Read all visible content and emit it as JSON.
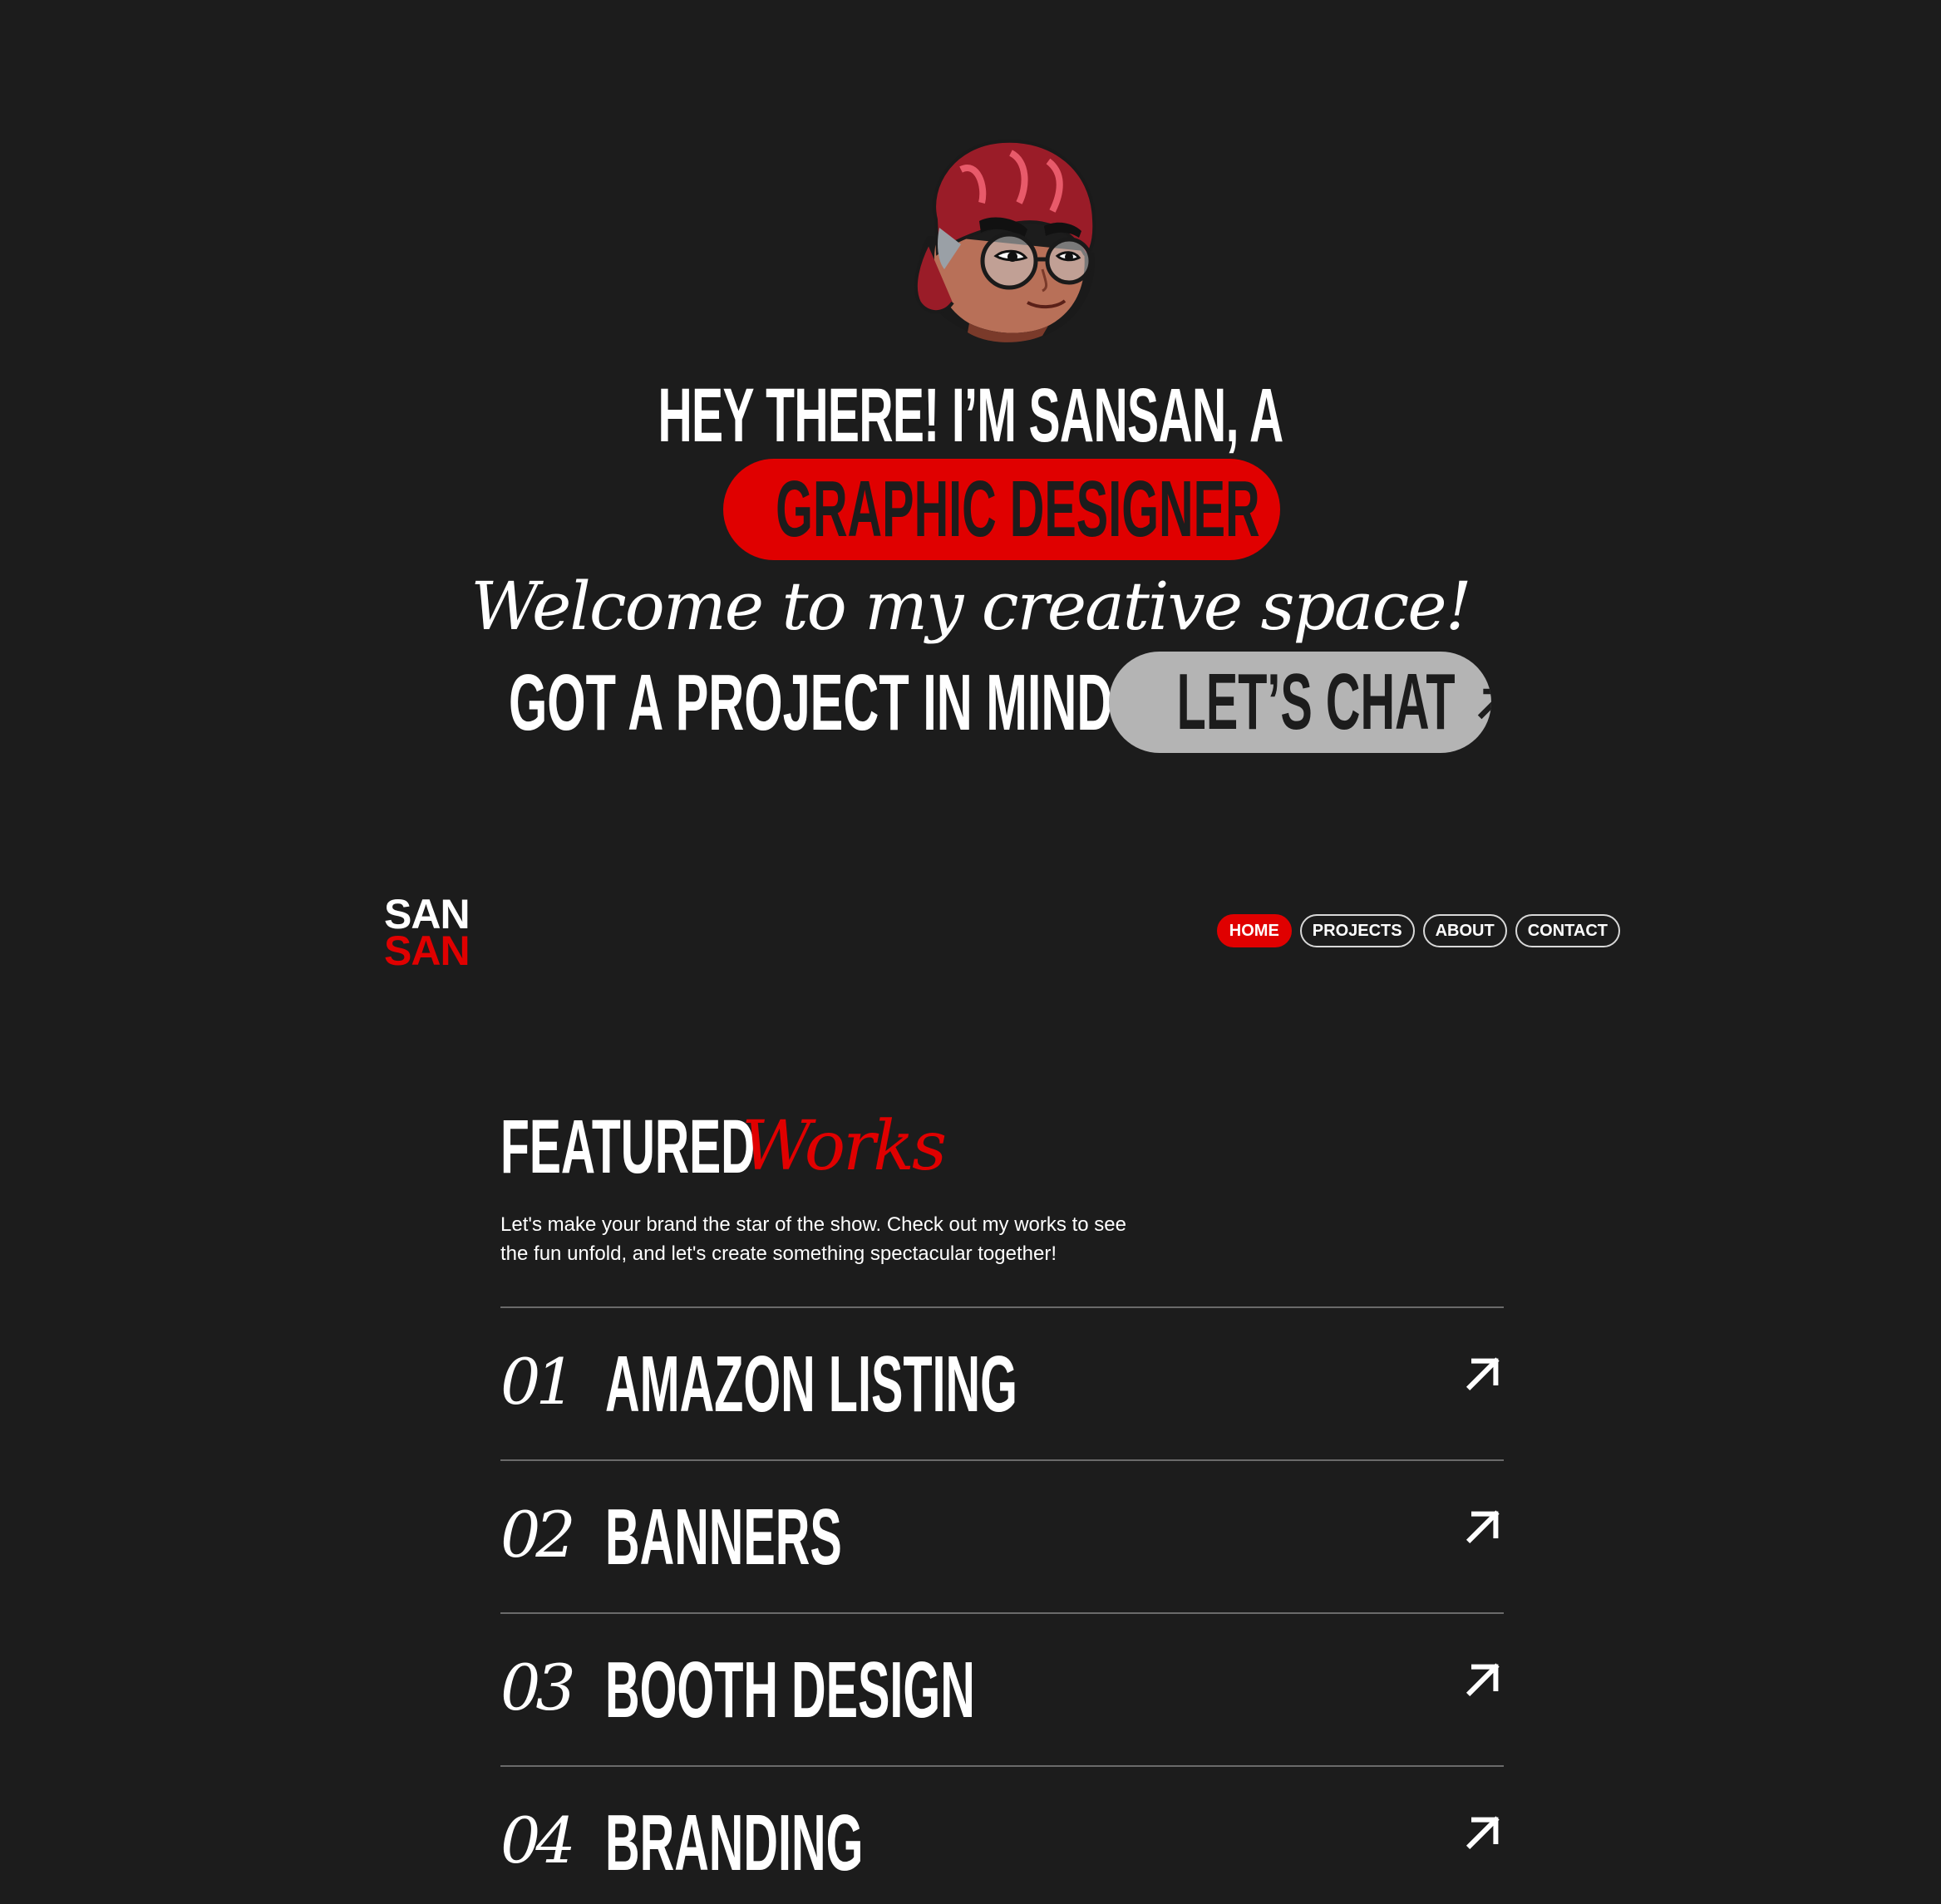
{
  "hero": {
    "avatar_icon": "cartoon-avatar-icon",
    "line1": "HEY THERE! I’M SANSAN, A",
    "role_button": "GRAPHIC DESIGNER",
    "welcome": "Welcome to my creative space!",
    "project_question": "GOT A PROJECT IN MIND?",
    "chat_button": "LET’S CHAT",
    "accent_color": "#e00000",
    "chat_color": "#b4b4b4"
  },
  "logo": {
    "line1": "SAN",
    "line2": "SAN"
  },
  "nav": {
    "items": [
      "HOME",
      "PROJECTS",
      "ABOUT",
      "CONTACT"
    ],
    "active": "HOME"
  },
  "featured": {
    "title_bold": "FEATURED",
    "title_script": "Works",
    "description": "Let's make your brand the star of the show. Check out my works to see the fun unfold, and let's create something spectacular together!",
    "items": [
      {
        "number": "01",
        "name": "AMAZON LISTING"
      },
      {
        "number": "02",
        "name": "BANNERS"
      },
      {
        "number": "03",
        "name": "BOOTH DESIGN"
      },
      {
        "number": "04",
        "name": "BRANDING"
      }
    ]
  }
}
